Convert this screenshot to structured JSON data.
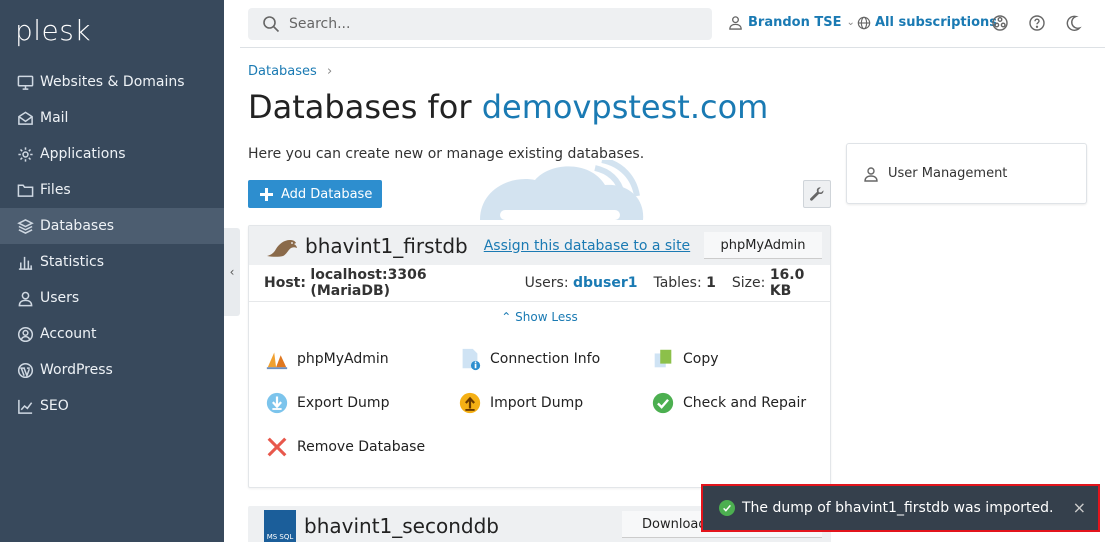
{
  "sidebar": {
    "logo": "plesk",
    "items": [
      {
        "label": "Websites & Domains",
        "icon": "monitor-icon",
        "active": false
      },
      {
        "label": "Mail",
        "icon": "mail-icon",
        "active": false
      },
      {
        "label": "Applications",
        "icon": "gear-icon",
        "active": false
      },
      {
        "label": "Files",
        "icon": "folder-icon",
        "active": false
      },
      {
        "label": "Databases",
        "icon": "database-icon",
        "active": true
      },
      {
        "label": "Statistics",
        "icon": "bar-chart-icon",
        "active": false
      },
      {
        "label": "Users",
        "icon": "user-icon",
        "active": false
      },
      {
        "label": "Account",
        "icon": "account-icon",
        "active": false
      },
      {
        "label": "WordPress",
        "icon": "wordpress-icon",
        "active": false
      },
      {
        "label": "SEO",
        "icon": "seo-icon",
        "active": false
      }
    ]
  },
  "header": {
    "search_placeholder": "Search...",
    "user": "Brandon TSE",
    "subscriptions": "All subscriptions"
  },
  "main": {
    "breadcrumb": "Databases",
    "title_prefix": "Databases for ",
    "title_domain": "demovpstest.com",
    "intro": "Here you can create new or manage existing databases.",
    "add_button": "Add Database",
    "side_panel": "User Management"
  },
  "db1": {
    "name": "bhavint1_firstdb",
    "assign_link": "Assign this database to a site",
    "pma_button": "phpMyAdmin",
    "host_label": "Host:",
    "host_value": "localhost:3306 (MariaDB)",
    "users_label": "Users:",
    "users_value": "dbuser1",
    "tables_label": "Tables:",
    "tables_value": "1",
    "size_label": "Size:",
    "size_value": "16.0 KB",
    "show_less": "Show Less",
    "actions": {
      "phpmyadmin": "phpMyAdmin",
      "connection_info": "Connection Info",
      "copy": "Copy",
      "export_dump": "Export Dump",
      "import_dump": "Import Dump",
      "check_repair": "Check and Repair",
      "remove": "Remove Database"
    }
  },
  "db2": {
    "name": "bhavint1_seconddb",
    "icon_text": "MS SQL",
    "download_button": "Download"
  },
  "toast": {
    "message": "The dump of bhavint1_firstdb was imported.",
    "close": "×"
  },
  "colors": {
    "sidebar_bg": "#38495c",
    "accent": "#1a7ab3",
    "primary_button": "#2d8ecf",
    "toast_bg": "#35404c",
    "toast_border": "#e3141c",
    "success": "#4caf50"
  }
}
